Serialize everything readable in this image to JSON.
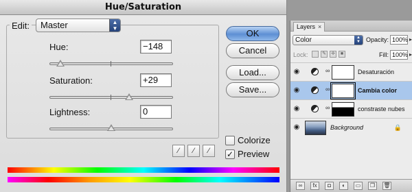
{
  "dialog": {
    "title": "Hue/Saturation",
    "edit_label": "Edit:",
    "edit_value": "Master",
    "hue": {
      "label": "Hue:",
      "value": "−148",
      "slider_fraction": 0.088
    },
    "saturation": {
      "label": "Saturation:",
      "value": "+29",
      "slider_fraction": 0.645
    },
    "lightness": {
      "label": "Lightness:",
      "value": "0",
      "slider_fraction": 0.5
    },
    "buttons": {
      "ok": "OK",
      "cancel": "Cancel",
      "load": "Load...",
      "save": "Save..."
    },
    "colorize": {
      "label": "Colorize",
      "checked": false
    },
    "preview": {
      "label": "Preview",
      "checked": true,
      "mark": "✓"
    }
  },
  "layers_panel": {
    "tab_label": "Layers",
    "tab_close": "×",
    "blend_mode": "Color",
    "opacity_label": "Opacity:",
    "opacity_value": "100%",
    "lock_label": "Lock:",
    "fill_label": "Fill:",
    "fill_value": "100%",
    "layers": [
      {
        "name": "Desaturación",
        "selected": false
      },
      {
        "name": "Cambia color",
        "selected": true
      },
      {
        "name": "constraste nubes",
        "selected": false
      },
      {
        "name": "Background",
        "selected": false,
        "locked": true
      }
    ]
  }
}
